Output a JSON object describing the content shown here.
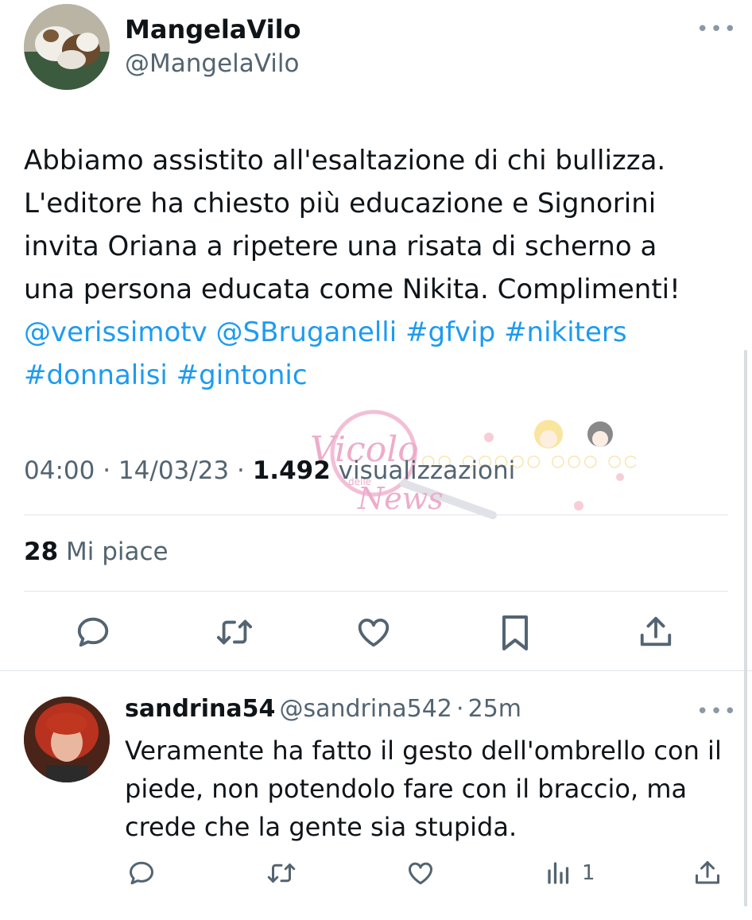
{
  "tweet": {
    "author_name": "MangelaVilo",
    "author_handle": "@MangelaVilo",
    "text_lines": [
      "Abbiamo assistito all'esaltazione di chi bullizza.",
      "L'editore ha chiesto più educazione e Signorini",
      "invita Oriana a ripetere una risata di scherno a",
      "una persona educata come Nikita. Complimenti!"
    ],
    "links_line1": [
      "@verissimotv",
      "@SBruganelli",
      "#gfvip",
      "#nikiters"
    ],
    "links_line2": [
      "#donnalisi",
      "#gintonic"
    ],
    "time": "04:00",
    "date": "14/03/23",
    "views_count": "1.492",
    "views_label": "visualizzazioni",
    "likes_count": "28",
    "likes_label": "Mi piace",
    "watermark_text": "Vicolo delle News"
  },
  "reply": {
    "author_name": "sandrina54",
    "author_handle": "@sandrina542",
    "age": "25m",
    "text_lines": [
      "Veramente ha fatto il gesto dell'ombrello con il",
      "piede, non potendolo fare con il braccio, ma",
      "crede che la gente sia stupida."
    ],
    "views_count": "1"
  },
  "icons": {
    "more": "more-icon",
    "reply": "reply-icon",
    "retweet": "retweet-icon",
    "like": "heart-icon",
    "bookmark": "bookmark-icon",
    "share": "share-icon",
    "views": "views-icon"
  },
  "colors": {
    "text": "#0f1419",
    "secondary": "#536471",
    "link": "#1d9bf0",
    "divider": "#e1e6ea"
  }
}
